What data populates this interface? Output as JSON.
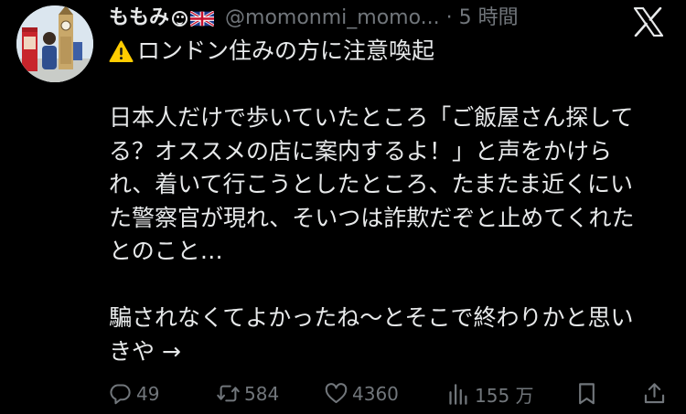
{
  "author": {
    "display_name": "ももみ",
    "handle": "@momonmi_momo...",
    "separator": "·",
    "timestamp": "5 時間"
  },
  "tweet": {
    "lines": [
      "ロンドン住みの方に注意喚起",
      "",
      "日本人だけで歩いていたところ「ご飯屋さん探して",
      "る？オススメの店に案内するよ！」と声をかけら",
      "れ、着いて行こうとしたところ、たまたま近くにい",
      "た警察官が現れ、そいつは詐欺だぞと止めてくれた",
      "とのこと…",
      "",
      "騙されなくてよかったね〜とそこで終わりかと思い",
      "きや →"
    ]
  },
  "metrics": {
    "replies": "49",
    "reposts": "584",
    "likes": "4360",
    "views": "155 万"
  },
  "icons": {
    "header_right": "x-logo-icon",
    "line_start": "warning-icon",
    "name_emojis": [
      "smiley-icon",
      "uk-flag-icon"
    ],
    "actions": [
      "reply-icon",
      "repost-icon",
      "like-icon",
      "views-icon",
      "bookmark-icon",
      "share-icon"
    ]
  },
  "colors": {
    "background": "#000000",
    "primary_text": "#e7e9ea",
    "secondary_text": "#71767b",
    "warning": "#ffcc00"
  }
}
